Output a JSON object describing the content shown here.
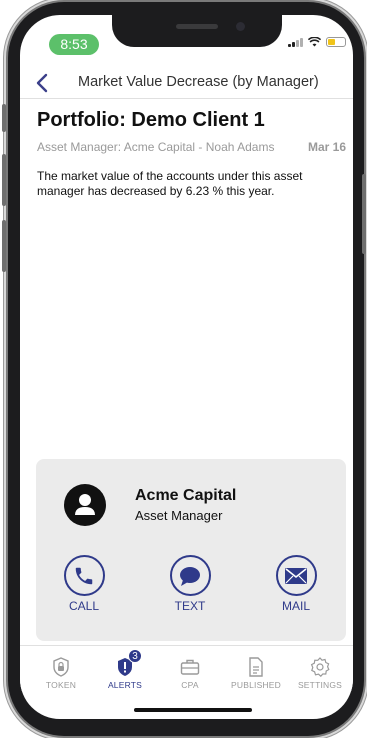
{
  "status_bar": {
    "time": "8:53"
  },
  "nav": {
    "title": "Market Value Decrease (by Manager)"
  },
  "alert": {
    "portfolio_title": "Portfolio: Demo Client 1",
    "manager_line": "Asset Manager: Acme Capital - Noah Adams",
    "date": "Mar 16",
    "message": "The market value of the accounts under this asset manager has decreased by 6.23 % this year."
  },
  "contact_card": {
    "name": "Acme Capital",
    "role": "Asset Manager",
    "actions": [
      {
        "label": "CALL",
        "icon": "phone-icon"
      },
      {
        "label": "TEXT",
        "icon": "chat-bubble-icon"
      },
      {
        "label": "MAIL",
        "icon": "envelope-icon"
      }
    ]
  },
  "tabbar": {
    "tabs": [
      {
        "label": "TOKEN",
        "icon": "lock-icon",
        "active": false
      },
      {
        "label": "ALERTS",
        "icon": "shield-alert-icon",
        "active": true,
        "badge": "3"
      },
      {
        "label": "CPA",
        "icon": "briefcase-icon",
        "active": false
      },
      {
        "label": "PUBLISHED",
        "icon": "document-icon",
        "active": false
      },
      {
        "label": "SETTINGS",
        "icon": "gear-icon",
        "active": false
      }
    ]
  },
  "colors": {
    "accent": "#2f3a8a",
    "time_pill": "#5cc06a",
    "card_background": "#ebebeb",
    "battery": "#f0c419"
  }
}
